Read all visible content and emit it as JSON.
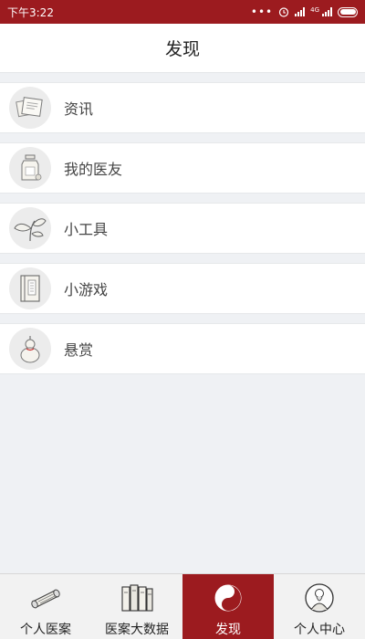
{
  "status_bar": {
    "time": "下午3:22",
    "network_label": "4G",
    "background_color": "#9c1b1f"
  },
  "header": {
    "title": "发现"
  },
  "menu": {
    "items": [
      {
        "label": "资讯",
        "icon": "papers-icon"
      },
      {
        "label": "我的医友",
        "icon": "medicine-jar-icon"
      },
      {
        "label": "小工具",
        "icon": "herb-leaf-icon"
      },
      {
        "label": "小游戏",
        "icon": "book-icon"
      },
      {
        "label": "悬赏",
        "icon": "gourd-icon"
      }
    ]
  },
  "bottom_nav": {
    "active_index": 2,
    "active_color": "#9c1b1f",
    "items": [
      {
        "label": "个人医案",
        "icon": "scroll-icon"
      },
      {
        "label": "医案大数据",
        "icon": "books-icon"
      },
      {
        "label": "发现",
        "icon": "yin-yang-icon"
      },
      {
        "label": "个人中心",
        "icon": "sage-avatar-icon"
      }
    ]
  }
}
